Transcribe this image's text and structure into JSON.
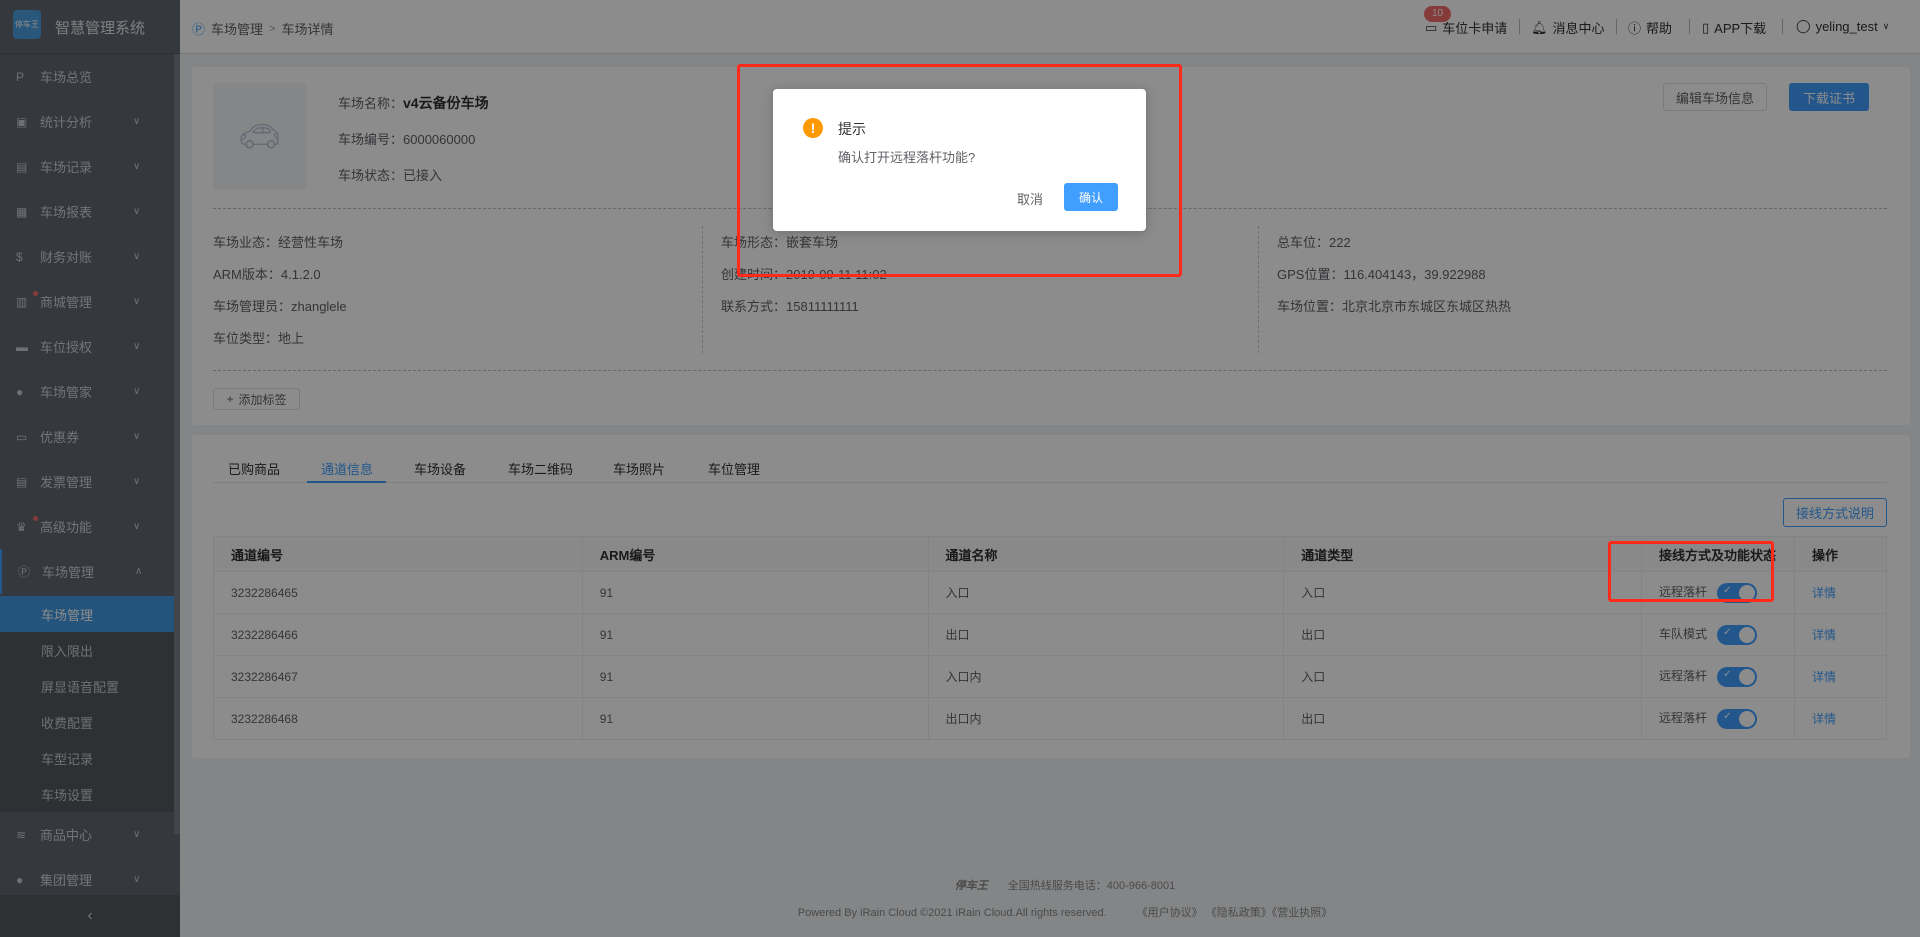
{
  "app": {
    "title": "智慧管理系统",
    "logo_text": "停车王"
  },
  "sidebar": {
    "items": [
      {
        "label": "车场总览",
        "icon": "P",
        "chevron": false,
        "dot": false
      },
      {
        "label": "统计分析",
        "icon": "▣",
        "chevron": true,
        "dot": false
      },
      {
        "label": "车场记录",
        "icon": "▤",
        "chevron": true,
        "dot": false
      },
      {
        "label": "车场报表",
        "icon": "▦",
        "chevron": true,
        "dot": false
      },
      {
        "label": "财务对账",
        "icon": "$",
        "chevron": true,
        "dot": false
      },
      {
        "label": "商城管理",
        "icon": "▥",
        "chevron": true,
        "dot": true
      },
      {
        "label": "车位授权",
        "icon": "▬",
        "chevron": true,
        "dot": false
      },
      {
        "label": "车场管家",
        "icon": "●",
        "chevron": true,
        "dot": false
      },
      {
        "label": "优惠券",
        "icon": "▭",
        "chevron": true,
        "dot": false
      },
      {
        "label": "发票管理",
        "icon": "▤",
        "chevron": true,
        "dot": false
      },
      {
        "label": "高级功能",
        "icon": "♛",
        "chevron": true,
        "dot": true
      },
      {
        "label": "车场管理",
        "icon": "Ⓟ",
        "chevron": true,
        "open": true,
        "dot": false
      }
    ],
    "sub_items": [
      {
        "label": "车场管理",
        "active": true
      },
      {
        "label": "限入限出"
      },
      {
        "label": "屏显语音配置"
      },
      {
        "label": "收费配置"
      },
      {
        "label": "车型记录"
      },
      {
        "label": "车场设置"
      }
    ],
    "bottom_items": [
      {
        "label": "商品中心",
        "icon": "≋",
        "chevron": true
      },
      {
        "label": "集团管理",
        "icon": "●",
        "chevron": true
      }
    ]
  },
  "header": {
    "breadcrumb": [
      "车场管理",
      "车场详情"
    ],
    "breadcrumb_sep": ">",
    "card_apply": "车位卡申请",
    "card_apply_badge": "10",
    "messages": "消息中心",
    "help": "帮助",
    "app_download": "APP下载",
    "user": "yeling_test"
  },
  "lot": {
    "name_label": "车场名称：",
    "name": "v4云备份车场",
    "number": "车场编号：6000060000",
    "status": "车场状态：已接入",
    "edit_button": "编辑车场信息",
    "download_button": "下载证书",
    "details": [
      [
        "车场业态：经营性车场",
        "ARM版本：4.1.2.0",
        "车场管理员：zhanglele",
        "车位类型：地上"
      ],
      [
        "车场形态：嵌套车场",
        "创建时间：2019-09-11 11:02",
        "联系方式：15811111111"
      ],
      [
        "总车位：222",
        "GPS位置：116.404143，39.922988",
        "车场位置：北京北京市东城区东城区热热"
      ]
    ],
    "add_tag": "添加标签"
  },
  "tabs": [
    {
      "label": "已购商品"
    },
    {
      "label": "通道信息",
      "active": true
    },
    {
      "label": "车场设备"
    },
    {
      "label": "车场二维码"
    },
    {
      "label": "车场照片"
    },
    {
      "label": "车位管理"
    }
  ],
  "wiring_help_button": "接线方式说明",
  "table": {
    "columns": [
      "通道编号",
      "ARM编号",
      "通道名称",
      "通道类型",
      "接线方式及功能状态",
      "操作"
    ],
    "rows": [
      {
        "id": "3232286465",
        "arm": "91",
        "name": "入口",
        "type": "入口",
        "mode": "远程落杆",
        "enabled": true,
        "action": "详情"
      },
      {
        "id": "3232286466",
        "arm": "91",
        "name": "出口",
        "type": "出口",
        "mode": "车队模式",
        "enabled": true,
        "action": "详情"
      },
      {
        "id": "3232286467",
        "arm": "91",
        "name": "入口内",
        "type": "入口",
        "mode": "远程落杆",
        "enabled": true,
        "action": "详情"
      },
      {
        "id": "3232286468",
        "arm": "91",
        "name": "出口内",
        "type": "出口",
        "mode": "远程落杆",
        "enabled": true,
        "action": "详情"
      }
    ]
  },
  "footer": {
    "brand": "停车王",
    "hotline": "全国热线服务电话：400-966-8001",
    "copyright": "Powered By iRain Cloud ©2021 iRain Cloud.All rights reserved.",
    "links": [
      "《用户协议》",
      "《隐私政策》",
      "《营业执照》"
    ]
  },
  "dialog": {
    "title": "提示",
    "message": "确认打开远程落杆功能?",
    "cancel": "取消",
    "confirm": "确认"
  },
  "colors": {
    "primary": "#409eff",
    "warning": "#ff9900",
    "annotation": "#ff2a1a"
  }
}
